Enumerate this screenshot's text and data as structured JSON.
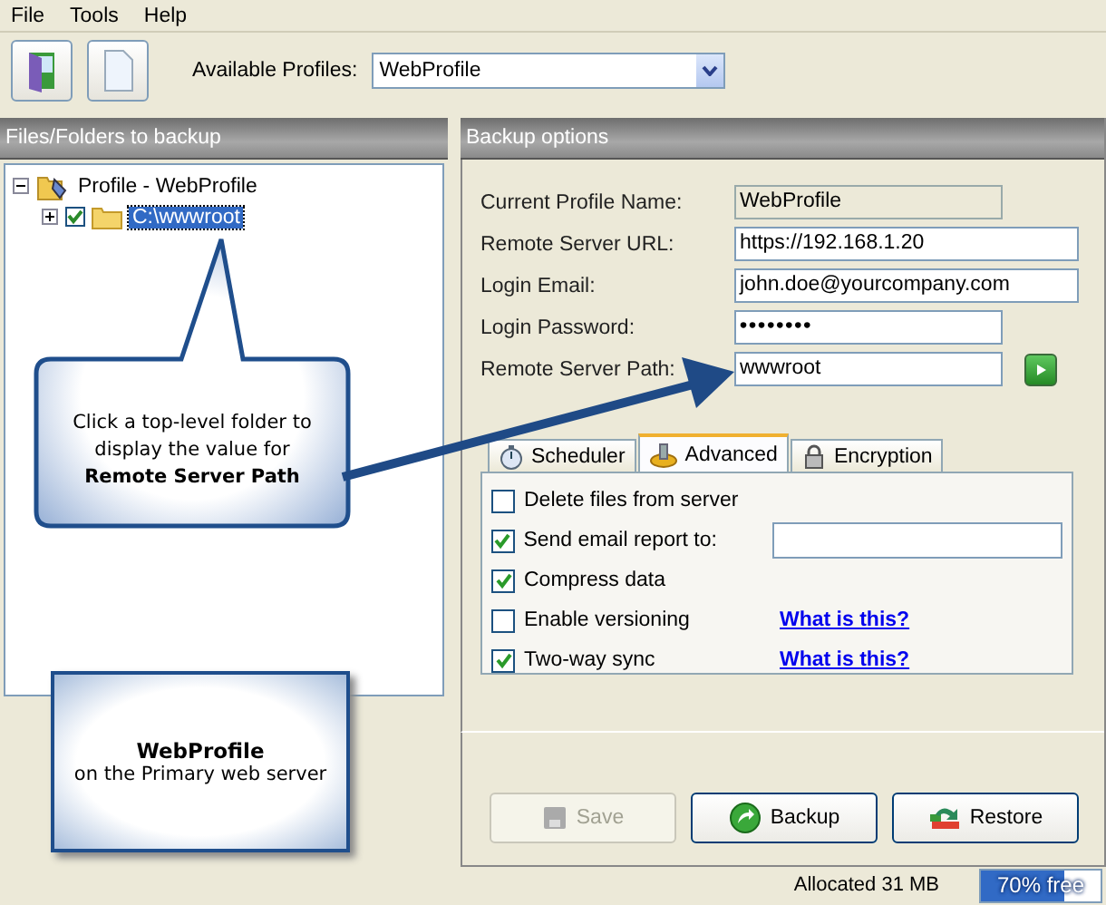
{
  "menu": [
    "File",
    "Tools",
    "Help"
  ],
  "toolbar": {
    "buttons": [
      {
        "kind": "door"
      },
      {
        "kind": "page"
      }
    ],
    "profiles_label": "Available Profiles:",
    "profiles_value": "WebProfile"
  },
  "left_panel": {
    "title": "Files/Folders to backup",
    "tree": [
      {
        "label": "Profile - WebProfile",
        "expanded": true,
        "selected": false,
        "children": [
          {
            "label": "C:\\wwwroot",
            "checked": true,
            "expanded": false,
            "selected": true
          }
        ]
      }
    ]
  },
  "callouts": [
    {
      "kind": "bubble",
      "text": "Click  a top-level folder to display the value for **Remote Server Path**"
    },
    {
      "kind": "box",
      "title": "WebProfile",
      "text": "on the Primary web server"
    }
  ],
  "right_panel": {
    "title": "Backup options",
    "fields": [
      {
        "label": "Current Profile Name:",
        "value": "WebProfile",
        "kind": "readonly"
      },
      {
        "label": "Remote Server URL:",
        "value": "https://192.168.1.20",
        "kind": "wide"
      },
      {
        "label": "Login Email:",
        "value": "john.doe@yourcompany.com",
        "kind": "wide"
      },
      {
        "label": "Login Password:",
        "value": "••••••••",
        "kind": "password"
      },
      {
        "label": "Remote Server Path:",
        "value": "wwwroot",
        "kind": "go"
      }
    ],
    "tabs": [
      {
        "label": "Scheduler",
        "selected": false,
        "kind": "stopwatch"
      },
      {
        "label": "Advanced",
        "selected": true,
        "kind": "gear"
      },
      {
        "label": "Encryption",
        "selected": false,
        "kind": "lock"
      }
    ],
    "options": [
      {
        "label": "Delete files from server",
        "checked": false,
        "kind": "plain"
      },
      {
        "label": "Send email report to:",
        "checked": true,
        "kind": "input"
      },
      {
        "label": "Compress data",
        "checked": true,
        "kind": "plain"
      },
      {
        "label": "Enable versioning",
        "checked": false,
        "kind": "link",
        "link": "What is this?"
      },
      {
        "label": "Two-way sync",
        "checked": true,
        "kind": "link",
        "link": "What is this?"
      }
    ],
    "buttons": [
      {
        "label": "Save",
        "disabled": true,
        "kind": "save"
      },
      {
        "label": "Backup",
        "disabled": false,
        "kind": "backup"
      },
      {
        "label": "Restore",
        "disabled": false,
        "kind": "restore"
      }
    ]
  },
  "status_bar": {
    "text": "Allocated 31 MB",
    "meter": {
      "label": "70% free",
      "level": 0.7
    }
  }
}
